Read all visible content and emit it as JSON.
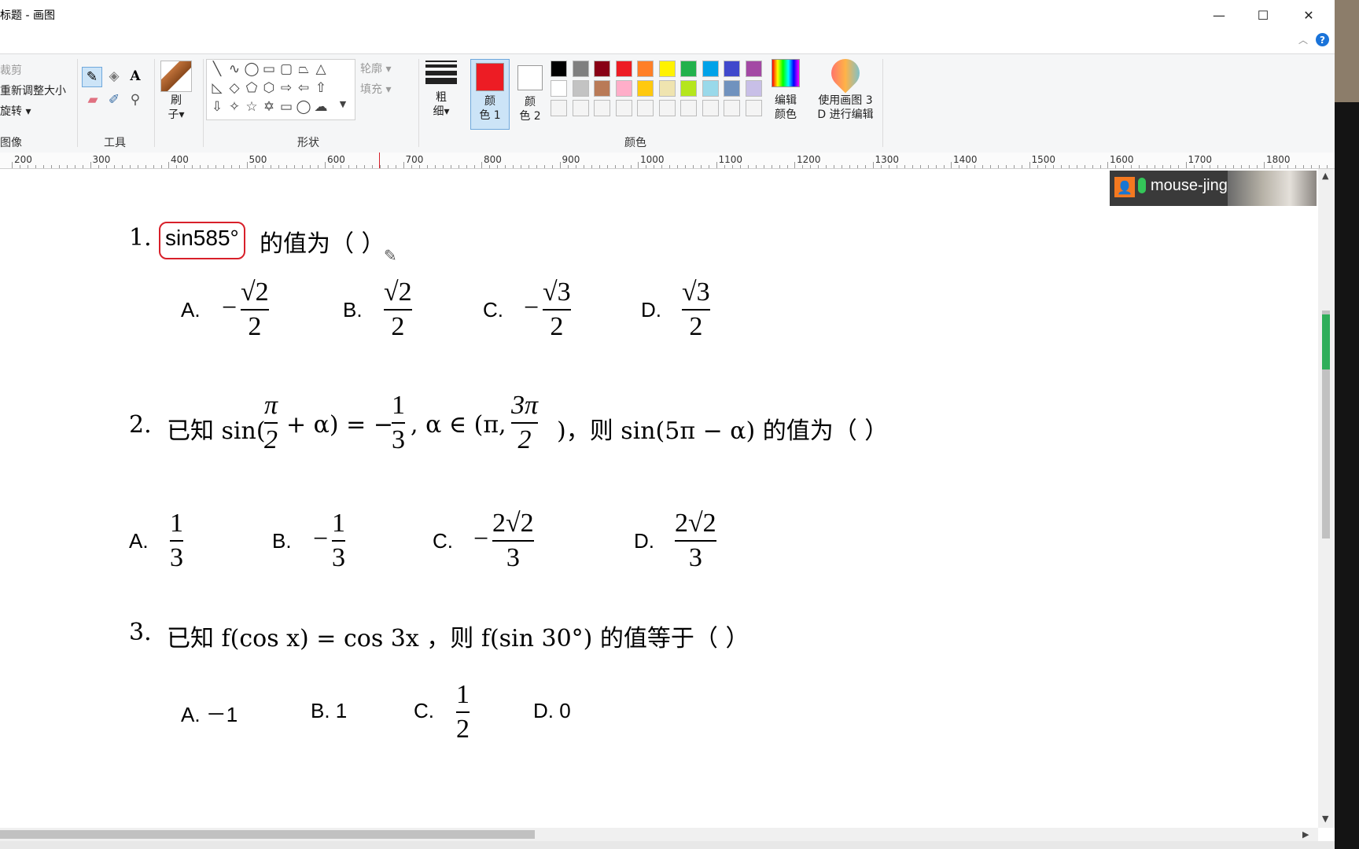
{
  "window": {
    "title": "标题 - 画图",
    "minimize": "—",
    "maximize": "☐",
    "close": "✕"
  },
  "help": {
    "collapse_icon": "chevron-up-icon",
    "help_icon": "?"
  },
  "ribbon": {
    "image_group": {
      "crop": "裁剪",
      "resize": "重新调整大小",
      "rotate": "旋转 ▾",
      "label": "图像"
    },
    "tools_group": {
      "label": "工具"
    },
    "brush": {
      "label1": "刷",
      "label2": "子▾"
    },
    "shapes_group": {
      "label": "形状",
      "outline": "轮廓 ▾",
      "fill": "填充 ▾"
    },
    "size": {
      "label1": "粗",
      "label2": "细▾"
    },
    "color1": {
      "label1": "颜",
      "label2": "色 1",
      "value": "#ed1c24"
    },
    "color2": {
      "label1": "颜",
      "label2": "色 2",
      "value": "#ffffff"
    },
    "colors_group": {
      "label": "颜色"
    },
    "edit_colors": {
      "label1": "编辑",
      "label2": "颜色"
    },
    "paint3d": {
      "label1": "使用画图 3",
      "label2": "D 进行编辑"
    },
    "palette_row1": [
      "#000000",
      "#7f7f7f",
      "#880015",
      "#ed1c24",
      "#ff7f27",
      "#fff200",
      "#22b14c",
      "#00a2e8",
      "#3f48cc",
      "#a349a4"
    ],
    "palette_row2": [
      "#ffffff",
      "#c3c3c3",
      "#b97a57",
      "#ffaec9",
      "#ffc90e",
      "#efe4b0",
      "#b5e61d",
      "#99d9ea",
      "#7092be",
      "#c8bfe7"
    ],
    "palette_row3": [
      "#ffffff",
      "#ffffff",
      "#ffffff",
      "#ffffff",
      "#ffffff",
      "#ffffff",
      "#ffffff",
      "#ffffff",
      "#ffffff",
      "#ffffff"
    ]
  },
  "ruler": {
    "ticks": [
      "200",
      "300",
      "400",
      "500",
      "600",
      "700",
      "800",
      "900",
      "1000",
      "1100",
      "1200",
      "1300",
      "1400",
      "1500",
      "1600",
      "1700",
      "1800"
    ]
  },
  "webcam": {
    "name": "mouse-jing"
  },
  "questions": {
    "q1": {
      "num": "1.",
      "highlight": "sin585°",
      "suffix": "的值为（        ）",
      "options": [
        {
          "label": "A.",
          "sign": "−",
          "num": "√2",
          "den": "2"
        },
        {
          "label": "B.",
          "sign": "",
          "num": "√2",
          "den": "2"
        },
        {
          "label": "C.",
          "sign": "−",
          "num": "√3",
          "den": "2"
        },
        {
          "label": "D.",
          "sign": "",
          "num": "√3",
          "den": "2"
        }
      ]
    },
    "q2": {
      "num": "2.",
      "text_a": "已知 sin(",
      "frac1_num": "π",
      "frac1_den": "2",
      "text_b": "+ α) = −",
      "frac2_num": "1",
      "frac2_den": "3",
      "text_c": ", α ∈ (π,",
      "frac3_num": "3π",
      "frac3_den": "2",
      "text_d": ")，则 sin(5π − α) 的值为（       ）",
      "options": [
        {
          "label": "A.",
          "sign": "",
          "num": "1",
          "den": "3"
        },
        {
          "label": "B.",
          "sign": "−",
          "num": "1",
          "den": "3"
        },
        {
          "label": "C.",
          "sign": "−",
          "num": "2√2",
          "den": "3"
        },
        {
          "label": "D.",
          "sign": "",
          "num": "2√2",
          "den": "3"
        }
      ]
    },
    "q3": {
      "num": "3.",
      "text": "已知 f(cos x) = cos 3x ，则 f(sin 30°) 的值等于（        ）",
      "opt_a": "A. －1",
      "opt_b": "B. 1",
      "opt_c_label": "C.",
      "opt_c_num": "1",
      "opt_c_den": "2",
      "opt_d": "D. 0"
    }
  }
}
